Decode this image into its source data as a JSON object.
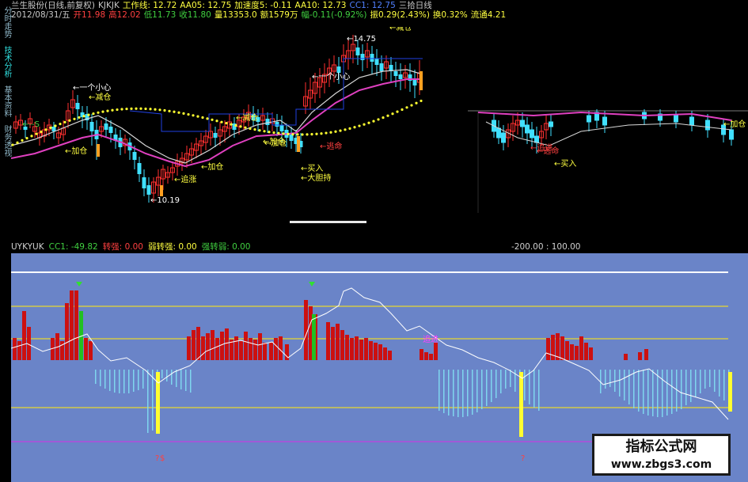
{
  "sidebar": {
    "tabs": [
      {
        "label": "分时走势"
      },
      {
        "label": "技术分析"
      },
      {
        "label": "基本资料"
      },
      {
        "label": "财务透视"
      }
    ]
  },
  "header": {
    "line1": [
      {
        "text": "兰生股份(日线,前复权)",
        "color": "#c8c8c8"
      },
      {
        "text": "KJKJK",
        "color": "#c8c8c8"
      },
      {
        "text": "工作线: 12.72",
        "color": "#ffff40"
      },
      {
        "text": "AA05: 12.75",
        "color": "#ffff40"
      },
      {
        "text": "加速度5: -0.11",
        "color": "#ffff40"
      },
      {
        "text": "AA10: 12.73",
        "color": "#ffff40"
      },
      {
        "text": "CC1: 12.75",
        "color": "#ffff40"
      },
      {
        "text": "三拾日线",
        "color": "#c8c8c8"
      }
    ],
    "line2": [
      {
        "text": "2012/08/31/五",
        "color": "#c8c8c8"
      },
      {
        "text": "开11.98",
        "color": "#ff4040"
      },
      {
        "text": "高12.02",
        "color": "#ff4040"
      },
      {
        "text": "低11.73",
        "color": "#40d040"
      },
      {
        "text": "收11.80",
        "color": "#40d040"
      },
      {
        "text": "量13353.0",
        "color": "#ffff40"
      },
      {
        "text": "额1579万",
        "color": "#ffff40"
      },
      {
        "text": "幅-0.11(-0.92%)",
        "color": "#40d040"
      },
      {
        "text": "振0.29(2.43%)",
        "color": "#ffff40"
      },
      {
        "text": "换0.32%",
        "color": "#ffff40"
      },
      {
        "text": "流通4.21",
        "color": "#ffff40"
      }
    ]
  },
  "price_annotations": [
    {
      "text": "一个小心",
      "color": "#ffffff"
    },
    {
      "text": "减仓",
      "color": "#ffff40"
    },
    {
      "text": "--S",
      "color": "#40d040"
    },
    {
      "text": "加仓",
      "color": "#ffff40"
    },
    {
      "text": "10.19",
      "color": "#ffffff"
    },
    {
      "text": "追涨",
      "color": "#ffff40"
    },
    {
      "text": "加仓",
      "color": "#ffff40"
    },
    {
      "text": "减仓",
      "color": "#ffff40"
    },
    {
      "text": "加仓",
      "color": "#ffff40"
    },
    {
      "text": "加仓",
      "color": "#ffff40"
    },
    {
      "text": "14.75",
      "color": "#ffffff"
    },
    {
      "text": "减仓",
      "color": "#ffff40"
    },
    {
      "text": "一个小心",
      "color": "#ffffff"
    },
    {
      "text": "买入",
      "color": "#ffff40"
    },
    {
      "text": "大胆持",
      "color": "#ffff40"
    },
    {
      "text": "逃命",
      "color": "#ff4040"
    },
    {
      "text": "逃命",
      "color": "#ff4040"
    },
    {
      "text": "追进",
      "color": "#ff4040"
    },
    {
      "text": "买入",
      "color": "#ffff40"
    },
    {
      "text": "加仓",
      "color": "#ffff40"
    }
  ],
  "indicator_header": [
    {
      "text": "UYKYUK",
      "color": "#d0d0d0"
    },
    {
      "text": "CC1: -49.82",
      "color": "#40d040"
    },
    {
      "text": "转强: 0.00",
      "color": "#ff4040"
    },
    {
      "text": "弱转强: 0.00",
      "color": "#ffff40"
    },
    {
      "text": "强转弱: 0.00",
      "color": "#40d040"
    },
    {
      "text": "-200.00 : 100.00",
      "color": "#d0d0d0"
    }
  ],
  "indicator_marks": [
    {
      "text": "$",
      "color": "#ff4040"
    },
    {
      "text": "追进",
      "color": "#ff40ff"
    },
    {
      "text": "?",
      "color": "#ff4040"
    },
    {
      "text": "?",
      "color": "#ff4040"
    }
  ],
  "watermark": {
    "title": "指标公式网",
    "url": "www.zbgs3.com"
  },
  "colors": {
    "background": "#000000",
    "indicator_bg": "#6a84c8",
    "bar_up": "#cc1010",
    "bar_down": "#7fd6ee",
    "strong_bar": "#ffff30",
    "green_bar": "#22c022",
    "ma_magenta": "#e040c0",
    "ma_white": "#d8d8d8",
    "ma_dots": "#ffff30",
    "hline_yellow": "#e8d830"
  }
}
